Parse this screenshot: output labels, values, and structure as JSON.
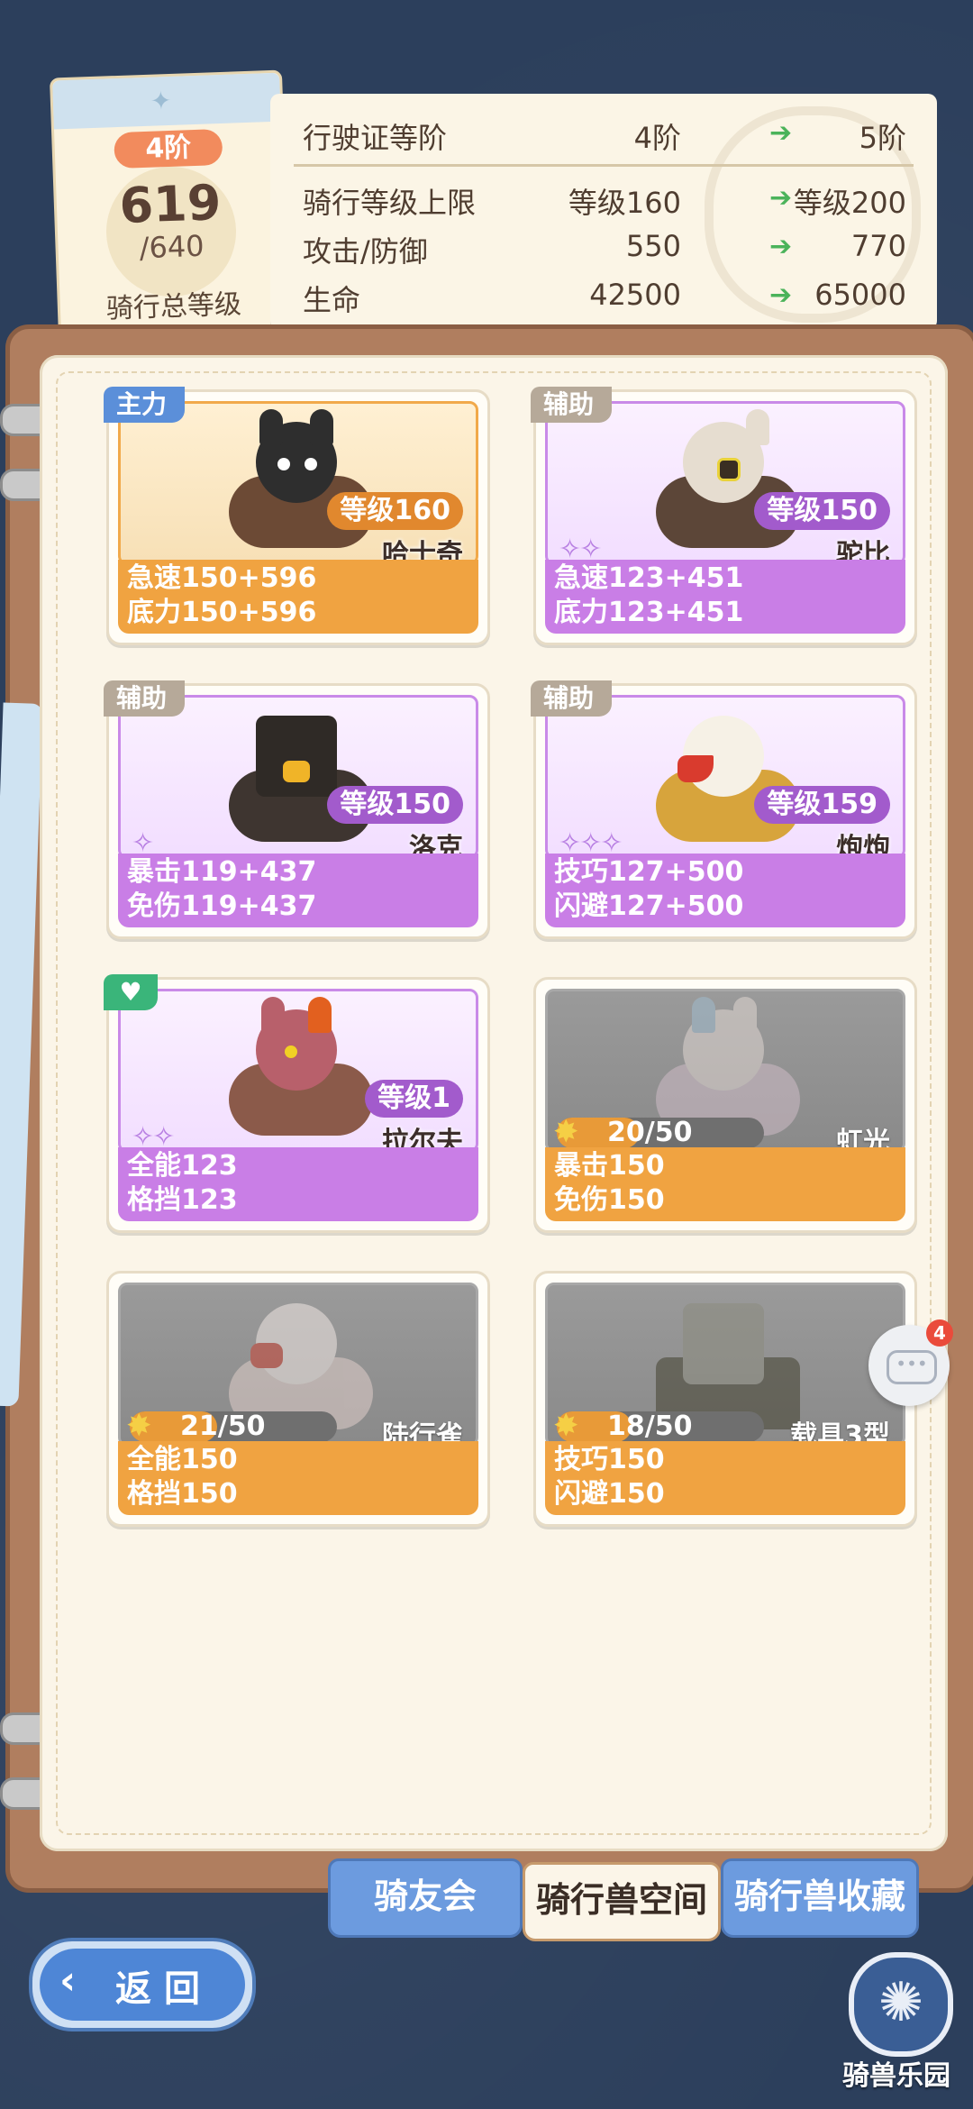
{
  "rank": {
    "tier": "4阶",
    "value": "619",
    "max": "/640",
    "caption": "骑行总等级"
  },
  "stats": [
    {
      "label": "行驶证等阶",
      "current": "4阶",
      "next": "5阶"
    },
    {
      "label": "骑行等级上限",
      "current": "等级160",
      "next": "等级200"
    },
    {
      "label": "攻击/防御",
      "current": "550",
      "next": "770"
    },
    {
      "label": "生命",
      "current": "42500",
      "next": "65000"
    }
  ],
  "mounts": [
    {
      "role": "主力",
      "level": "等级160",
      "name": "哈士奇",
      "stat1": "急速150+596",
      "stat2": "底力150+596",
      "stars": "",
      "locked": false,
      "theme": "orange"
    },
    {
      "role": "辅助",
      "level": "等级150",
      "name": "驼比",
      "stat1": "急速123+451",
      "stat2": "底力123+451",
      "stars": "✧✧",
      "locked": false,
      "theme": "purple"
    },
    {
      "role": "辅助",
      "level": "等级150",
      "name": "洛克",
      "stat1": "暴击119+437",
      "stat2": "免伤119+437",
      "stars": "✧",
      "locked": false,
      "theme": "purple"
    },
    {
      "role": "辅助",
      "level": "等级159",
      "name": "炮炮",
      "stat1": "技巧127+500",
      "stat2": "闪避127+500",
      "stars": "✧✧✧",
      "locked": false,
      "theme": "purple"
    },
    {
      "role": "♥",
      "level": "等级1",
      "name": "拉尔夫",
      "stat1": "全能123",
      "stat2": "格挡123",
      "stars": "✧✧",
      "locked": false,
      "theme": "purple"
    },
    {
      "role": "",
      "progress": "20/50",
      "progress_value": 0.4,
      "name": "虹光",
      "stat1": "暴击150",
      "stat2": "免伤150",
      "locked": true,
      "theme": "grey"
    },
    {
      "role": "",
      "progress": "21/50",
      "progress_value": 0.42,
      "name": "陆行雀",
      "stat1": "全能150",
      "stat2": "格挡150",
      "locked": true,
      "theme": "grey"
    },
    {
      "role": "",
      "progress": "18/50",
      "progress_value": 0.36,
      "name": "载具3型",
      "stat1": "技巧150",
      "stat2": "闪避150",
      "locked": true,
      "theme": "grey"
    }
  ],
  "chat": {
    "badge": "4"
  },
  "tabs": [
    {
      "label": "骑友会",
      "active": false
    },
    {
      "label": "骑行兽空间",
      "active": true
    },
    {
      "label": "骑行兽收藏",
      "active": false
    }
  ],
  "back_label": "返回",
  "park_label": "骑兽乐园",
  "colors": {
    "accent_orange": "#f0a341",
    "accent_purple": "#c97ee6",
    "tab_blue": "#6c9bdf",
    "arrow_green": "#4bb35a"
  }
}
